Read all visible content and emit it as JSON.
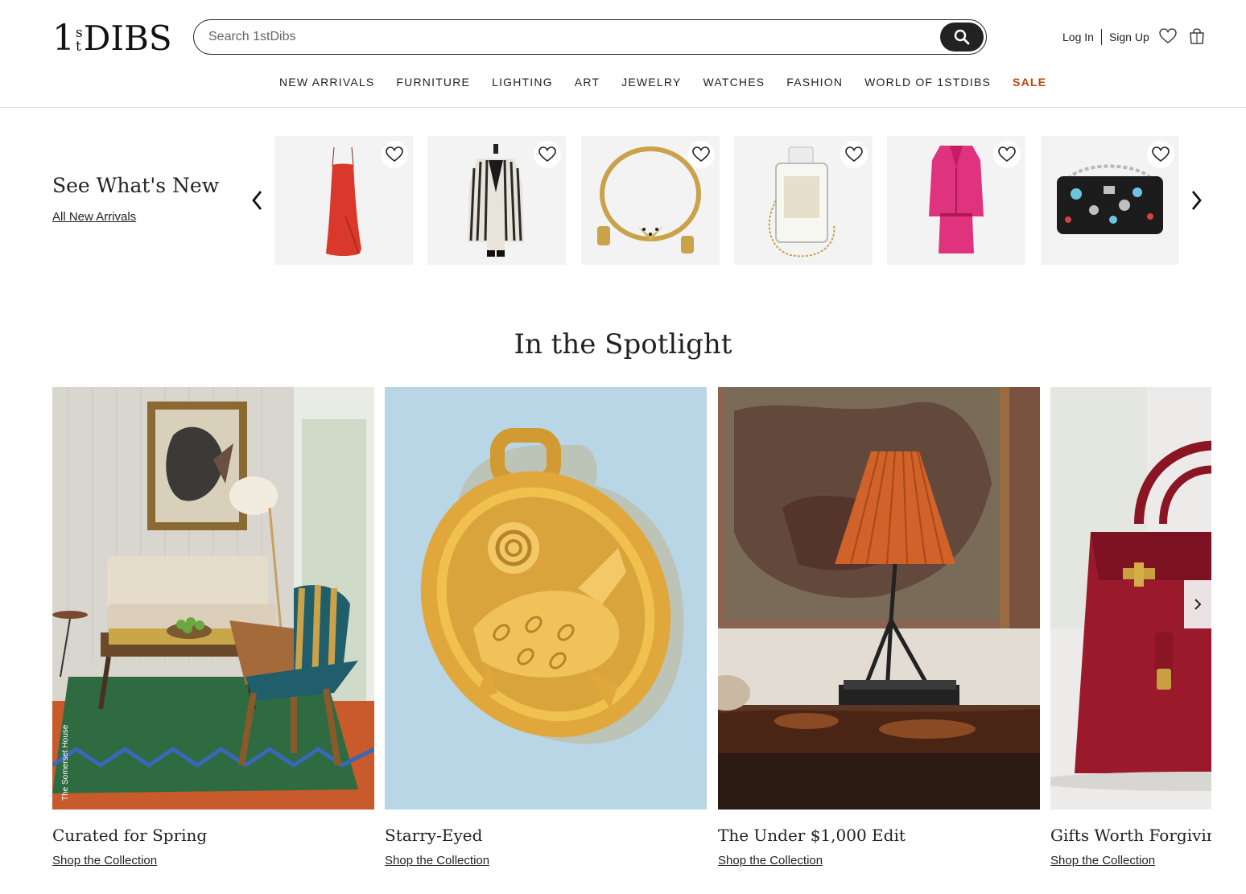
{
  "brand": {
    "logo_one": "1",
    "logo_s": "s",
    "logo_t": "t",
    "logo_dibs": "DIBS"
  },
  "search": {
    "placeholder": "Search 1stDibs",
    "button_icon": "search-icon"
  },
  "account": {
    "login": "Log In",
    "signup": "Sign Up",
    "favorites_icon": "heart-icon",
    "cart_icon": "shopping-bag-icon"
  },
  "nav": {
    "items": [
      "NEW ARRIVALS",
      "FURNITURE",
      "LIGHTING",
      "ART",
      "JEWELRY",
      "WATCHES",
      "FASHION",
      "WORLD OF 1STDIBS"
    ],
    "sale": "SALE",
    "sale_color": "#c2410c"
  },
  "whats_new": {
    "title": "See What's New",
    "link": "All New Arrivals",
    "items": [
      {
        "name": "red-slip-dress",
        "fav_icon": "heart-icon"
      },
      {
        "name": "striped-blazer",
        "fav_icon": "heart-icon"
      },
      {
        "name": "gold-panther-necklace",
        "fav_icon": "heart-icon"
      },
      {
        "name": "perfume-bottle-bag",
        "fav_icon": "heart-icon"
      },
      {
        "name": "pink-tweed-suit",
        "fav_icon": "heart-icon"
      },
      {
        "name": "embellished-flap-bag",
        "fav_icon": "heart-icon"
      }
    ]
  },
  "spotlight": {
    "title": "In the Spotlight",
    "cards": [
      {
        "name": "Curated for Spring",
        "link": "Shop the Collection",
        "credit": "The Somerset House"
      },
      {
        "name": "Starry-Eyed",
        "link": "Shop the Collection"
      },
      {
        "name": "The Under $1,000 Edit",
        "link": "Shop the Collection"
      },
      {
        "name": "Gifts Worth Forgiving",
        "link": "Shop the Collection"
      }
    ]
  }
}
